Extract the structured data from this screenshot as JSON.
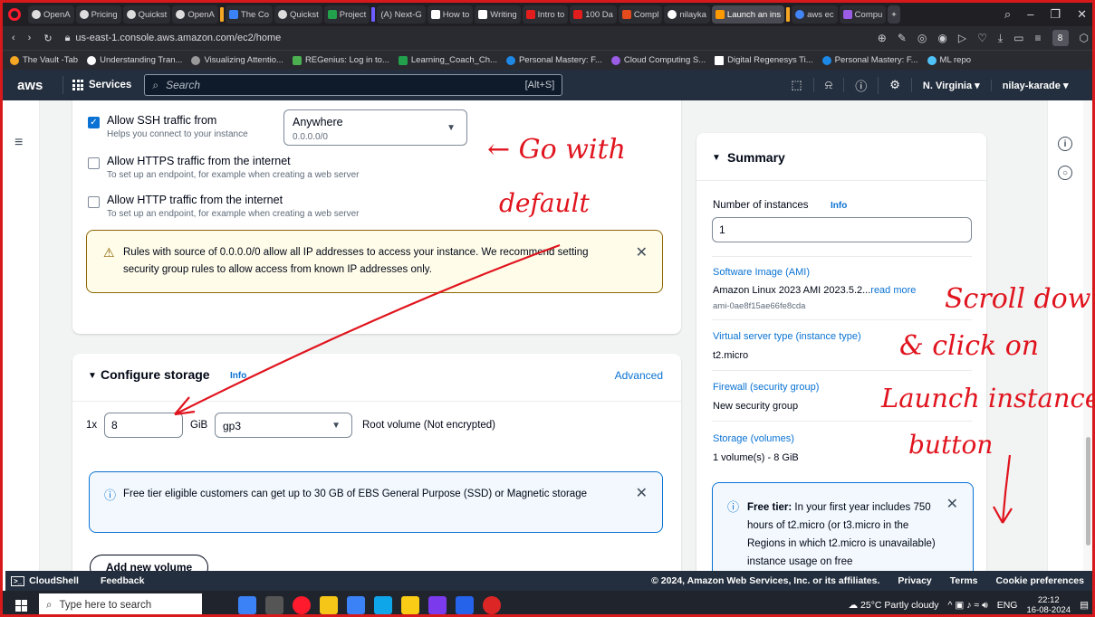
{
  "browser": {
    "tabs": [
      "OpenA",
      "Pricing",
      "Quickst",
      "OpenA",
      "The Co",
      "Quickst",
      "Project",
      "(A) Next-G",
      "How to",
      "Writing",
      "Intro to",
      "100 Da",
      "Compl",
      "nilayka",
      "Launch an ins",
      "aws ec",
      "Compu"
    ],
    "url": "us-east-1.console.aws.amazon.com/ec2/home",
    "profile_letter": "8",
    "bookmarks": [
      "The Vault -Tab",
      "Understanding Tran...",
      "Visualizing Attentio...",
      "REGenius: Log in to...",
      "Learning_Coach_Ch...",
      "Personal Mastery: F...",
      "Cloud Computing S...",
      "Digital Regenesys Ti...",
      "Personal Mastery: F...",
      "ML repo"
    ]
  },
  "aws_nav": {
    "logo": "aws",
    "services": "Services",
    "search_placeholder": "Search",
    "search_shortcut": "[Alt+S]",
    "region": "N. Virginia ▾",
    "user": "nilay-karade ▾"
  },
  "network": {
    "ssh": {
      "label": "Allow SSH traffic from",
      "help": "Helps you connect to your instance",
      "checked": true,
      "source_value": "Anywhere",
      "source_sub": "0.0.0.0/0"
    },
    "https": {
      "label": "Allow HTTPS traffic from the internet",
      "help": "To set up an endpoint, for example when creating a web server",
      "checked": false
    },
    "http": {
      "label": "Allow HTTP traffic from the internet",
      "help": "To set up an endpoint, for example when creating a web server",
      "checked": false
    },
    "warning": "Rules with source of 0.0.0.0/0 allow all IP addresses to access your instance. We recommend setting security group rules to allow access from known IP addresses only."
  },
  "storage": {
    "title": "Configure storage",
    "info": "Info",
    "advanced": "Advanced",
    "multiplier": "1x",
    "size": "8",
    "unit": "GiB",
    "volume_type": "gp3",
    "root_note": "Root volume  (Not encrypted)",
    "free_tier_note": "Free tier eligible customers can get up to 30 GB of EBS General Purpose (SSD) or Magnetic storage",
    "add_volume": "Add new volume"
  },
  "summary": {
    "title": "Summary",
    "instances_label": "Number of instances",
    "instances_info": "Info",
    "instances_value": "1",
    "ami_label": "Software Image (AMI)",
    "ami_value": "Amazon Linux 2023 AMI 2023.5.2...",
    "ami_read_more": "read more",
    "ami_id": "ami-0ae8f15ae66fe8cda",
    "type_label": "Virtual server type (instance type)",
    "type_value": "t2.micro",
    "firewall_label": "Firewall (security group)",
    "firewall_value": "New security group",
    "storage_label": "Storage (volumes)",
    "storage_value": "1 volume(s) - 8 GiB",
    "free_tier_bold": "Free tier:",
    "free_tier_text": " In your first year includes 750 hours of t2.micro (or t3.micro in the Regions in which t2.micro is unavailable) instance usage on free"
  },
  "aws_footer": {
    "cloudshell": "CloudShell",
    "feedback": "Feedback",
    "copyright": "© 2024, Amazon Web Services, Inc. or its affiliates.",
    "privacy": "Privacy",
    "terms": "Terms",
    "cookies": "Cookie preferences"
  },
  "taskbar": {
    "search_placeholder": "Type here to search",
    "weather": "25°C  Partly cloudy",
    "lang": "ENG",
    "time": "22:12",
    "date": "16-08-2024"
  },
  "annotations": {
    "go_with": "← Go with",
    "default": "default",
    "scroll_down": "Scroll down",
    "click_on": "& click on",
    "launch_instance": "Launch instance",
    "button": "button"
  },
  "colors": {
    "aws_nav": "#232f3e",
    "link": "#0972d3",
    "annotation": "#e0141e",
    "warning_bg": "#fffce9"
  }
}
